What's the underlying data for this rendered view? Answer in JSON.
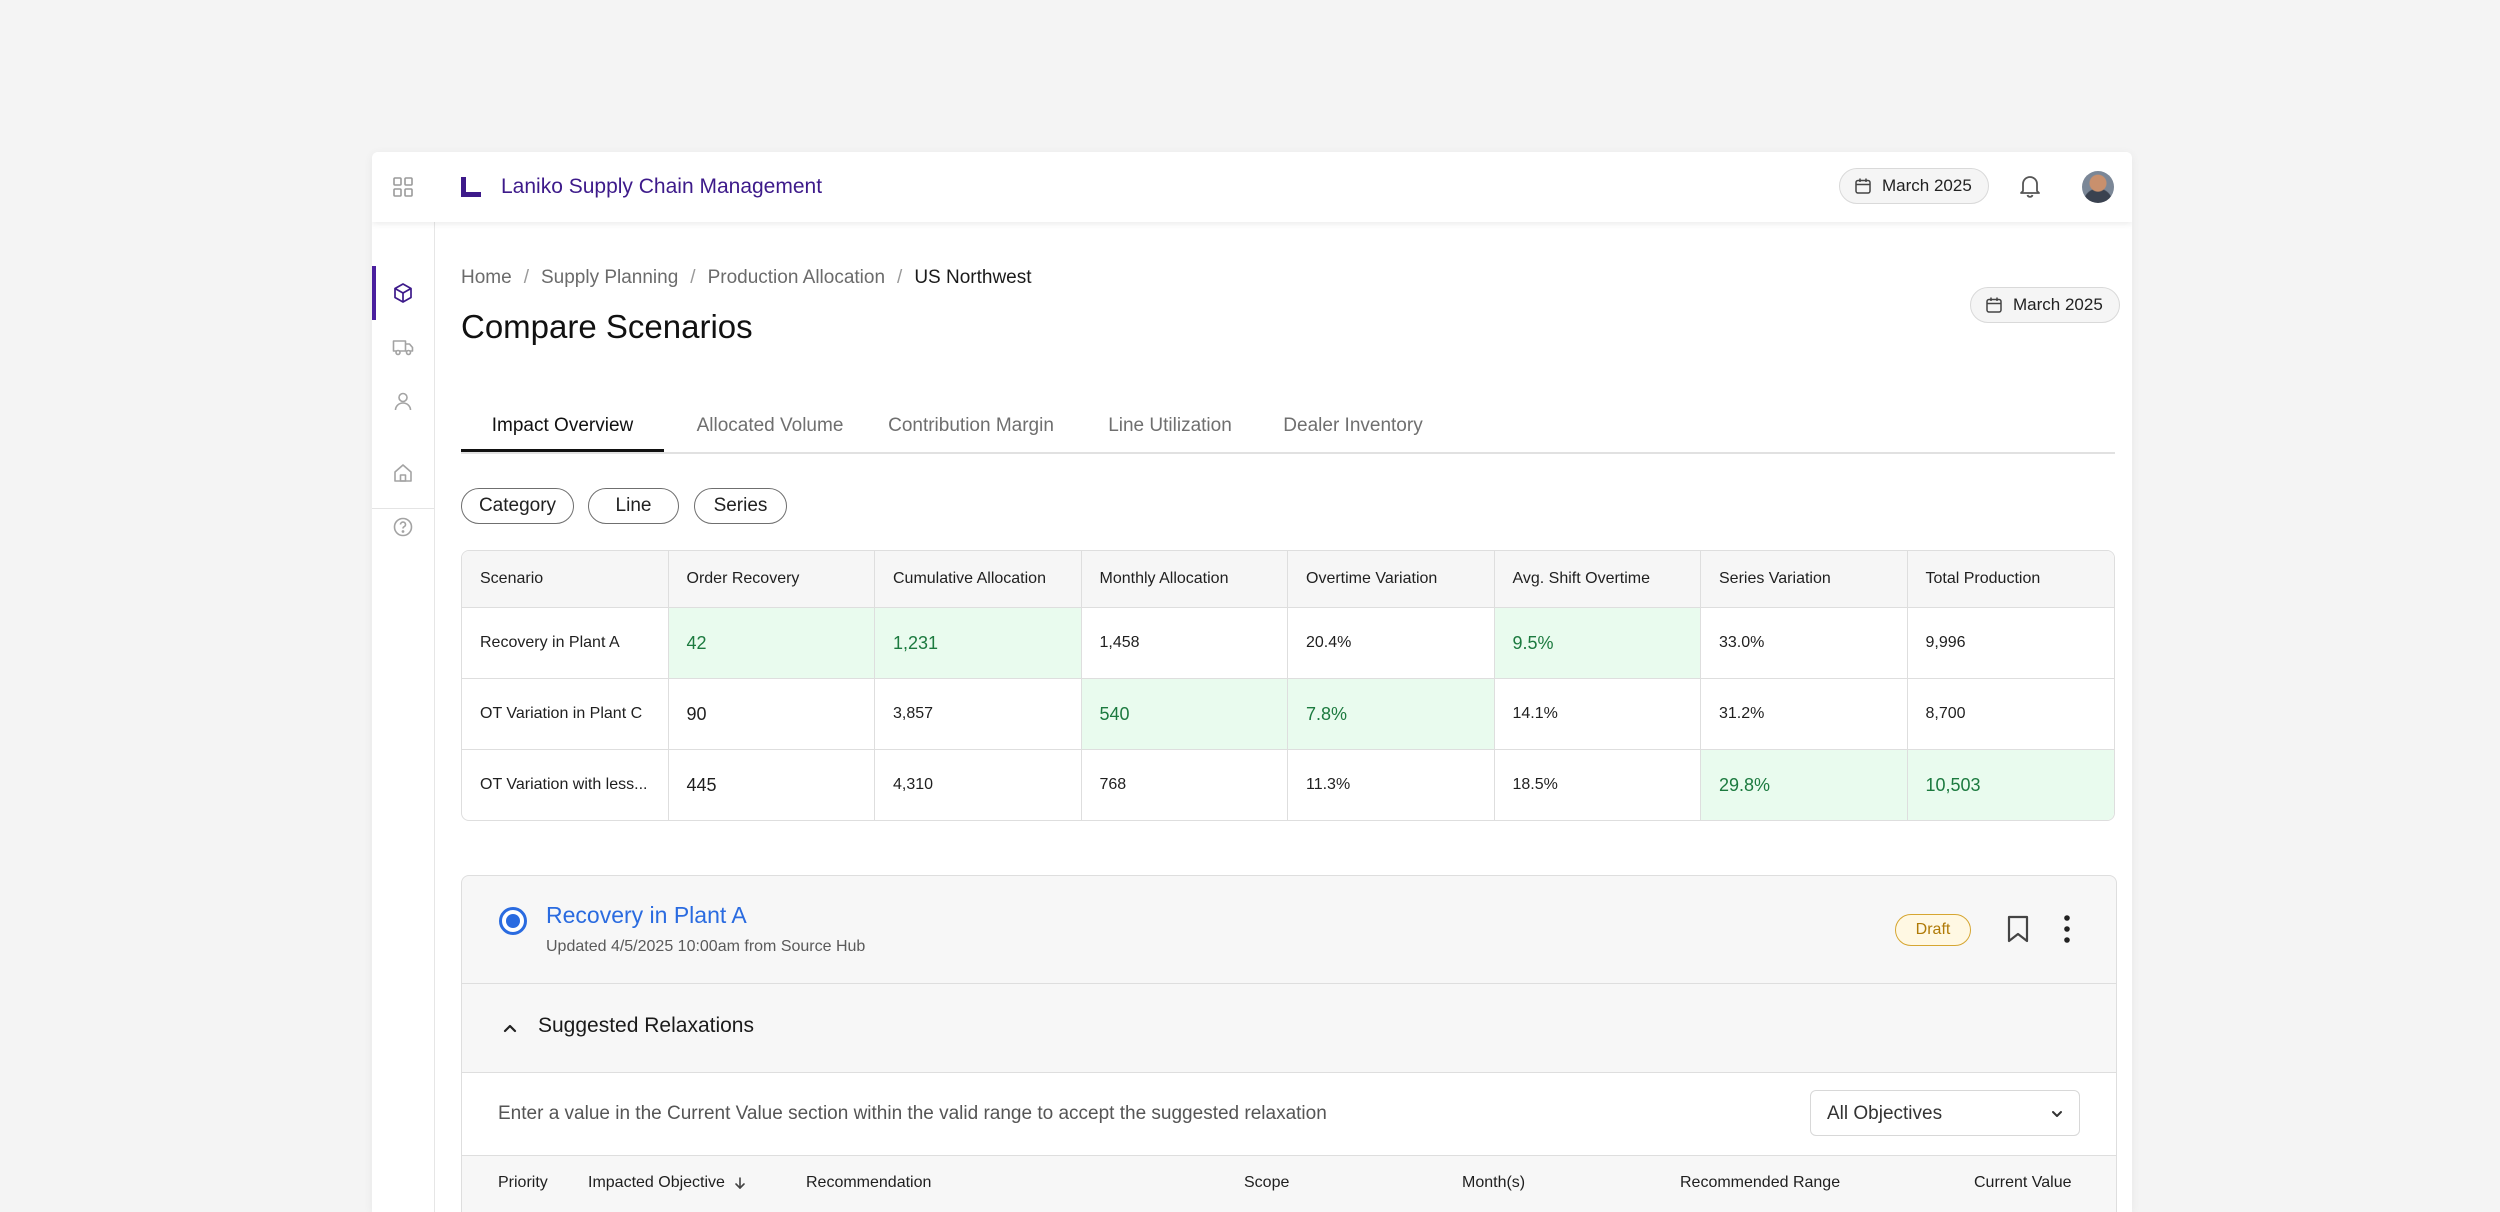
{
  "app": {
    "title": "Laniko Supply Chain Management",
    "date": "March 2025"
  },
  "breadcrumb": [
    "Home",
    "Supply Planning",
    "Production Allocation",
    "US Northwest"
  ],
  "page": {
    "title": "Compare Scenarios",
    "date": "March 2025"
  },
  "tabs": [
    "Impact Overview",
    "Allocated Volume",
    "Contribution Margin",
    "Line Utilization",
    "Dealer Inventory"
  ],
  "chips": [
    "Category",
    "Line",
    "Series"
  ],
  "table": {
    "columns": [
      "Scenario",
      "Order Recovery",
      "Cumulative Allocation",
      "Monthly Allocation",
      "Overtime Variation",
      "Avg. Shift Overtime",
      "Series Variation",
      "Total Production"
    ],
    "rows": [
      [
        "Recovery in Plant A",
        "42",
        "1,231",
        "1,458",
        "20.4%",
        "9.5%",
        "33.0%",
        "9,996"
      ],
      [
        "OT Variation in Plant C",
        "90",
        "3,857",
        "540",
        "7.8%",
        "14.1%",
        "31.2%",
        "8,700"
      ],
      [
        "OT Variation with less...",
        "445",
        "4,310",
        "768",
        "11.3%",
        "18.5%",
        "29.8%",
        "10,503"
      ]
    ]
  },
  "scenario": {
    "title": "Recovery in Plant A",
    "updated": "Updated 4/5/2025 10:00am from Source Hub",
    "status": "Draft",
    "section_title": "Suggested Relaxations",
    "hint": "Enter a value in the Current Value section within the valid range to accept the suggested relaxation",
    "filter": "All Objectives",
    "columns": [
      "Priority",
      "Impacted Objective",
      "Recommendation",
      "Scope",
      "Month(s)",
      "Recommended Range",
      "Current Value"
    ]
  },
  "colors": {
    "brand": "#3d1a8a",
    "accent": "#2a6be0",
    "highlight_bg": "#e9fbee",
    "highlight_text": "#1c7a3f",
    "draft": "#d6a632"
  },
  "icons": [
    "grid-icon",
    "logo-icon",
    "calendar-icon",
    "bell-icon",
    "cube-icon",
    "truck-icon",
    "user-icon",
    "home-icon",
    "help-icon",
    "radio-icon",
    "bookmark-icon",
    "kebab-icon",
    "chevron-up-icon",
    "chevron-down-icon",
    "sort-down-icon"
  ]
}
